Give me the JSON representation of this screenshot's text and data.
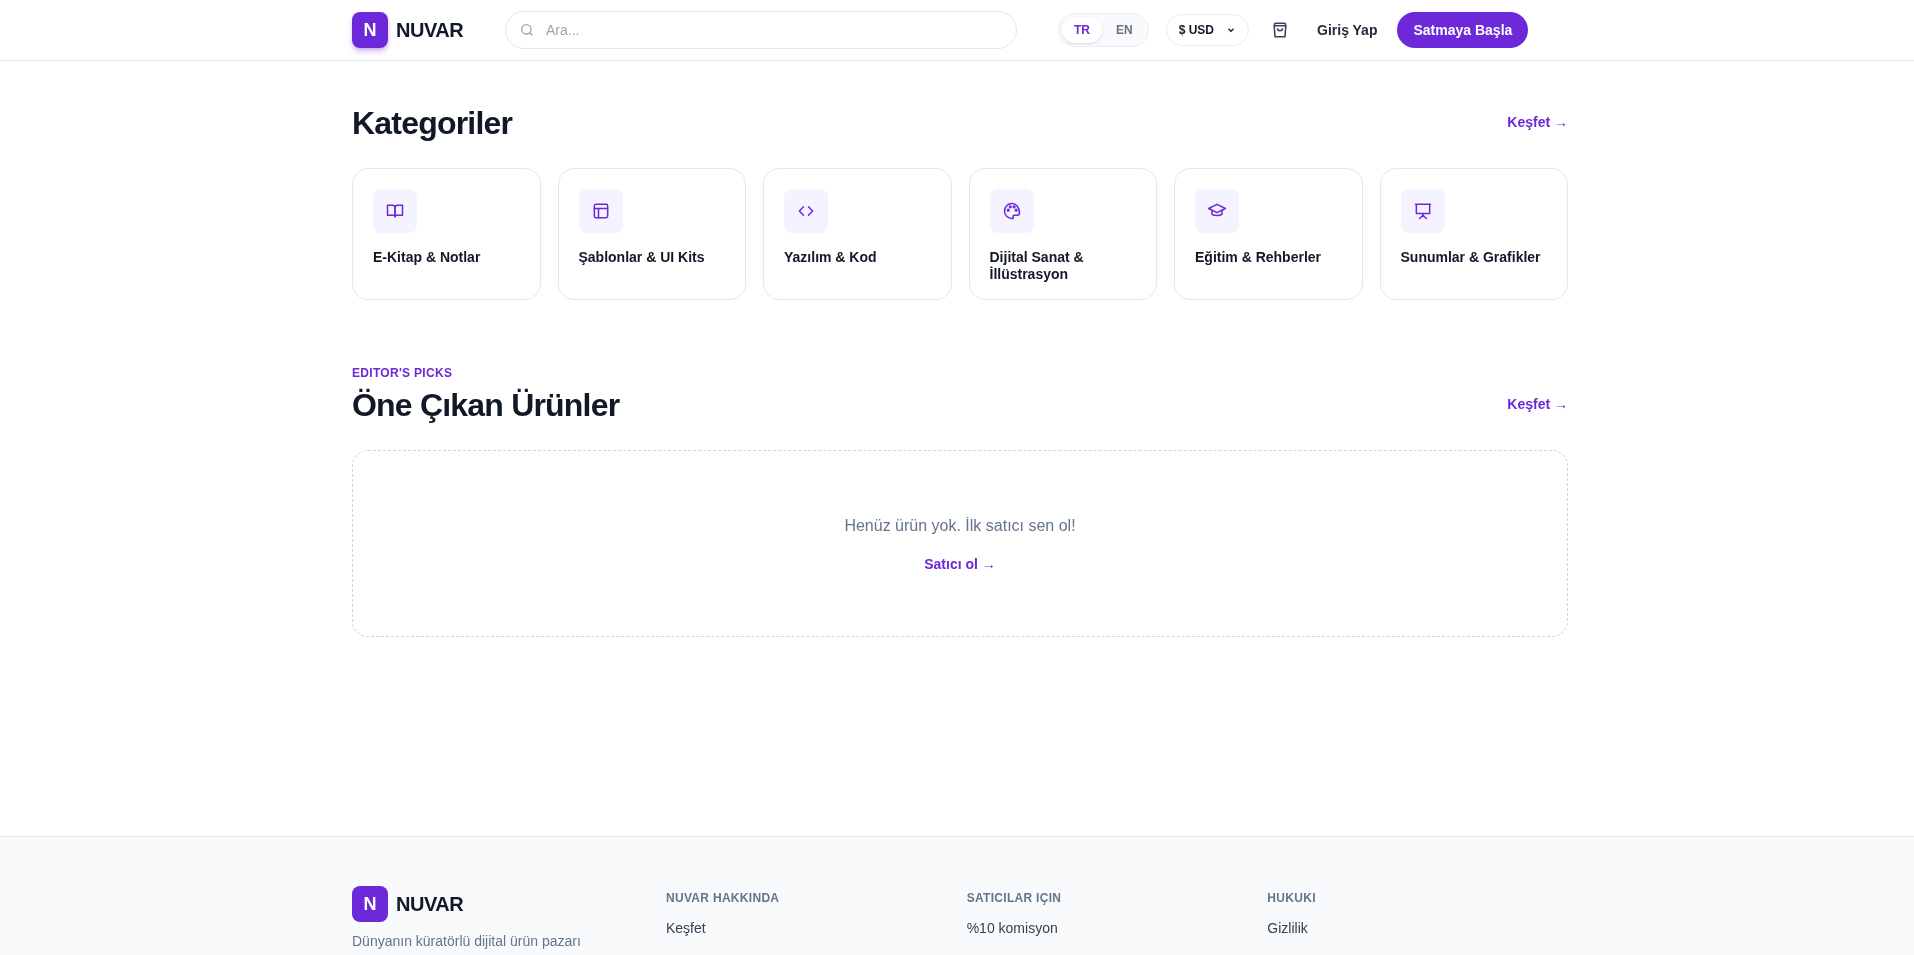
{
  "header": {
    "logo_letter": "N",
    "brand": "NUVAR",
    "search": {
      "placeholder": "Ara..."
    },
    "languages": [
      {
        "label": "TR",
        "selected": true
      },
      {
        "label": "EN",
        "selected": false
      }
    ],
    "currency": "$ USD",
    "login": "Giriş Yap",
    "cta": "Satmaya Başla"
  },
  "categories": {
    "title": "Kategoriler",
    "link": "Keşfet →",
    "items": [
      {
        "label": "E-Kitap & Notlar"
      },
      {
        "label": "Şablonlar & UI Kits"
      },
      {
        "label": "Yazılım & Kod"
      },
      {
        "label": "Dijital Sanat & İllüstrasyon"
      },
      {
        "label": "Eğitim & Rehberler"
      },
      {
        "label": "Sunumlar & Grafikler"
      }
    ]
  },
  "featured": {
    "eyebrow": "EDITOR'S PICKS",
    "title": "Öne Çıkan Ürünler",
    "link": "Keşfet →",
    "empty_message": "Henüz ürün yok. İlk satıcı sen ol!",
    "empty_link": "Satıcı ol →"
  },
  "footer": {
    "logo_letter": "N",
    "brand": "NUVAR",
    "description": "Dünyanın küratörlü dijital ürün pazarı",
    "columns": [
      {
        "heading": "NUVAR HAKKINDA",
        "links": [
          "Keşfet"
        ]
      },
      {
        "heading": "SATICILAR IÇIN",
        "links": [
          "%10 komisyon"
        ]
      },
      {
        "heading": "HUKUKI",
        "links": [
          "Gizlilik"
        ]
      }
    ]
  }
}
